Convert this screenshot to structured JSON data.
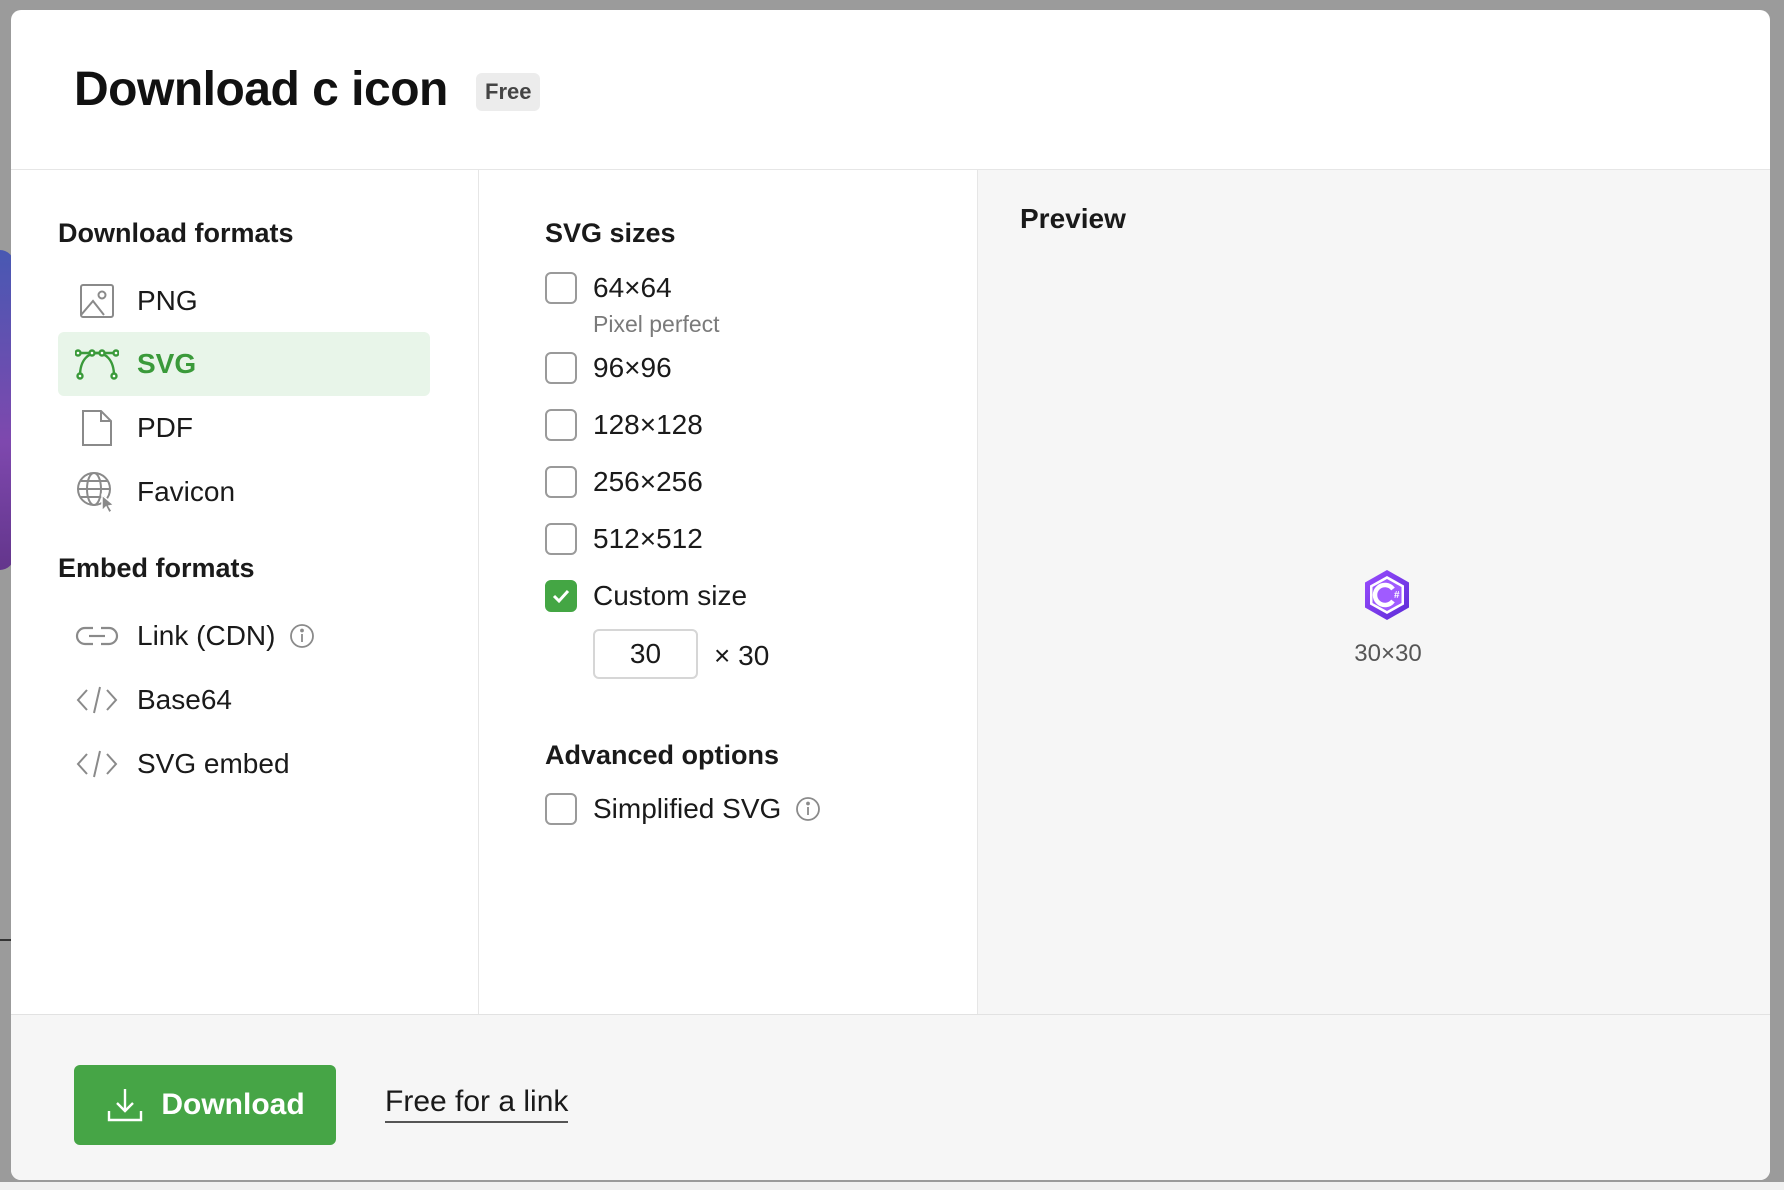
{
  "header": {
    "title": "Download c icon",
    "badge": "Free"
  },
  "download_formats": {
    "title": "Download formats",
    "items": [
      {
        "label": "PNG",
        "icon": "image-icon",
        "active": false
      },
      {
        "label": "SVG",
        "icon": "vector-path-icon",
        "active": true
      },
      {
        "label": "PDF",
        "icon": "document-icon",
        "active": false
      },
      {
        "label": "Favicon",
        "icon": "globe-cursor-icon",
        "active": false
      }
    ]
  },
  "embed_formats": {
    "title": "Embed formats",
    "items": [
      {
        "label": "Link (CDN)",
        "icon": "link-icon",
        "has_info": true
      },
      {
        "label": "Base64",
        "icon": "code-icon",
        "has_info": false
      },
      {
        "label": "SVG embed",
        "icon": "code-icon",
        "has_info": false
      }
    ]
  },
  "svg_sizes": {
    "title": "SVG sizes",
    "options": [
      {
        "label": "64×64",
        "checked": false,
        "note": "Pixel perfect"
      },
      {
        "label": "96×96",
        "checked": false
      },
      {
        "label": "128×128",
        "checked": false
      },
      {
        "label": "256×256",
        "checked": false
      },
      {
        "label": "512×512",
        "checked": false
      },
      {
        "label": "Custom size",
        "checked": true
      }
    ],
    "custom_width_value": "30",
    "custom_height_text": "× 30"
  },
  "advanced": {
    "title": "Advanced options",
    "simplified_label": "Simplified SVG",
    "simplified_checked": false
  },
  "preview": {
    "title": "Preview",
    "size_label": "30×30"
  },
  "footer": {
    "download_label": "Download",
    "free_link_label": "Free for a link"
  },
  "colors": {
    "accent_green": "#46a546",
    "active_bg": "#e8f5e9",
    "icon_purple": "#7b3fe4"
  }
}
